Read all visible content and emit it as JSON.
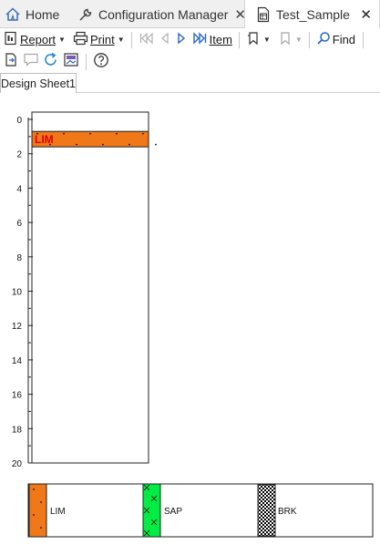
{
  "tabs": [
    {
      "label": "Home",
      "icon": "home-icon"
    },
    {
      "label": "Configuration Manager",
      "icon": "wrench-icon",
      "closable": true
    },
    {
      "label": "Test_Sample",
      "icon": "document-icon",
      "closable": true,
      "active": true
    }
  ],
  "toolbar": {
    "report_label": "Report",
    "print_label": "Print",
    "item_label": "Item",
    "find_label": "Find"
  },
  "sheets": [
    "Design Sheet1"
  ],
  "log": {
    "depth_ticks": [
      "0",
      "2",
      "4",
      "6",
      "8",
      "10",
      "12",
      "14",
      "16",
      "18",
      "20"
    ],
    "depth_min": 0,
    "depth_max": 20,
    "interval": {
      "top": 0.7,
      "bottom": 1.6,
      "label": "LIM",
      "color": "#f07818",
      "label_color": "#e00000"
    }
  },
  "legend": [
    {
      "label": "LIM",
      "color": "#f07818",
      "pattern": "dots"
    },
    {
      "label": "SAP",
      "color": "#00ee44",
      "pattern": "crosses"
    },
    {
      "label": "BRK",
      "color": "#000000",
      "pattern": "checker"
    }
  ]
}
